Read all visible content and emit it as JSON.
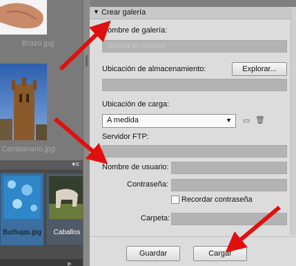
{
  "browser": {
    "thumbnails": [
      {
        "caption": "Brazo.jpg"
      },
      {
        "caption": "Campanario.jpg"
      }
    ],
    "filmstrip": [
      {
        "caption": "Burbujas.jpg"
      },
      {
        "caption": "Caballos"
      }
    ],
    "menu_icon": "panel-menu-icon"
  },
  "panel": {
    "section_title": "Crear galería",
    "gallery_name_label": "Nombre de galería:",
    "gallery_name_value": "Galería sin nombre",
    "storage_location_label": "Ubicación de almacenamiento:",
    "browse_button": "Explorar...",
    "upload_location_label": "Ubicación de carga:",
    "upload_location_value": "A medida",
    "ftp_server_label": "Servidor FTP:",
    "username_label": "Nombre de usuario:",
    "password_label": "Contraseña:",
    "remember_password_label": "Recordar contraseña",
    "folder_label": "Carpeta:",
    "save_button": "Guardar",
    "upload_button": "Cargar"
  },
  "colors": {
    "annotation_arrow": "#e01010",
    "panel_bg": "#dcdcdc",
    "field_bg": "#b3b3b3"
  }
}
